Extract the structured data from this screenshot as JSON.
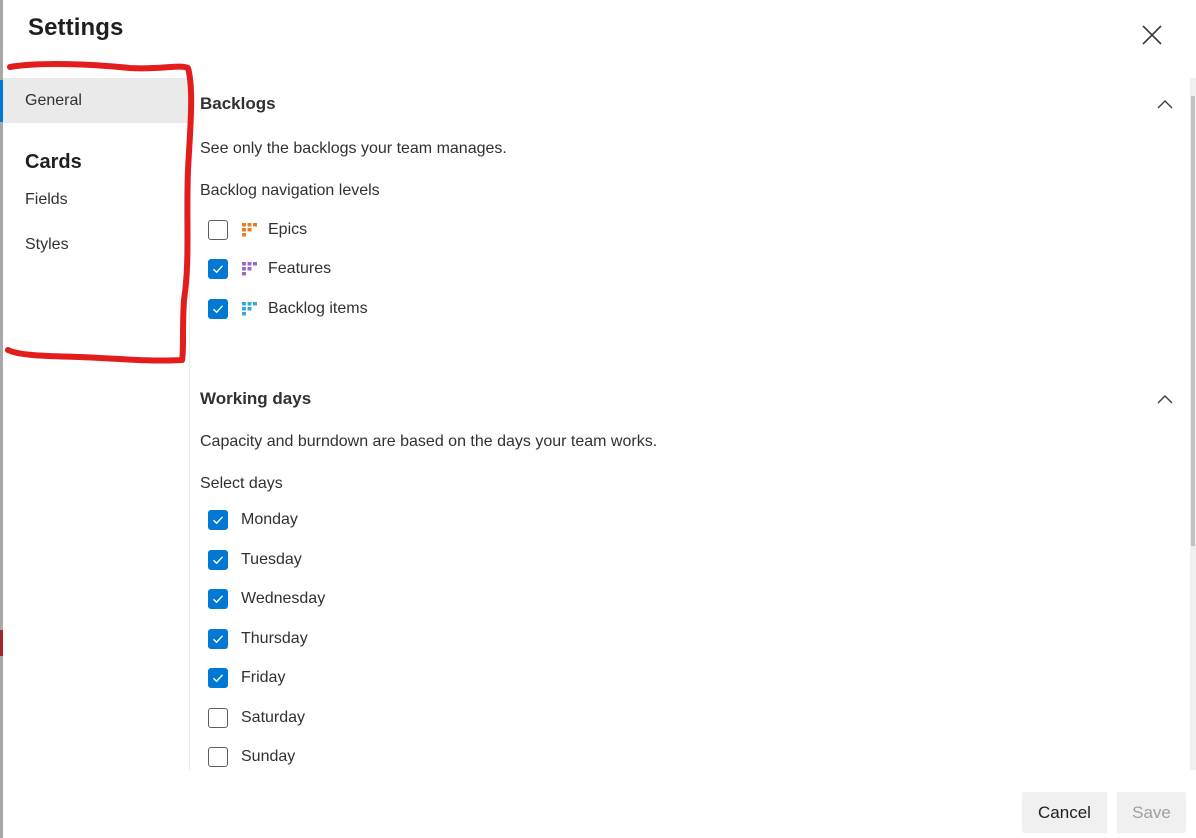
{
  "dialog": {
    "title": "Settings",
    "close_icon": "close-icon"
  },
  "nav": {
    "items": [
      {
        "label": "General",
        "selected": true
      }
    ],
    "groups": [
      {
        "label": "Cards",
        "items": [
          {
            "label": "Fields"
          },
          {
            "label": "Styles"
          }
        ]
      }
    ]
  },
  "backlogs": {
    "title": "Backlogs",
    "collapse_icon": "chevron-up-icon",
    "description": "See only the backlogs your team manages.",
    "sublabel": "Backlog navigation levels",
    "levels": [
      {
        "label": "Epics",
        "checked": false,
        "icon": "backlog-level-icon",
        "color": "#e87b25"
      },
      {
        "label": "Features",
        "checked": true,
        "icon": "backlog-level-icon",
        "color": "#9b6bc4"
      },
      {
        "label": "Backlog items",
        "checked": true,
        "icon": "backlog-level-icon",
        "color": "#35a9d8"
      }
    ]
  },
  "working_days": {
    "title": "Working days",
    "collapse_icon": "chevron-up-icon",
    "description": "Capacity and burndown are based on the days your team works.",
    "sublabel": "Select days",
    "days": [
      {
        "label": "Monday",
        "checked": true
      },
      {
        "label": "Tuesday",
        "checked": true
      },
      {
        "label": "Wednesday",
        "checked": true
      },
      {
        "label": "Thursday",
        "checked": true
      },
      {
        "label": "Friday",
        "checked": true
      },
      {
        "label": "Saturday",
        "checked": false
      },
      {
        "label": "Sunday",
        "checked": false
      }
    ]
  },
  "footer": {
    "cancel_label": "Cancel",
    "save_label": "Save",
    "save_enabled": false
  },
  "colors": {
    "accent": "#0078d4",
    "annotation": "#e31c1c",
    "selected_nav_bg": "#eaeaea"
  }
}
